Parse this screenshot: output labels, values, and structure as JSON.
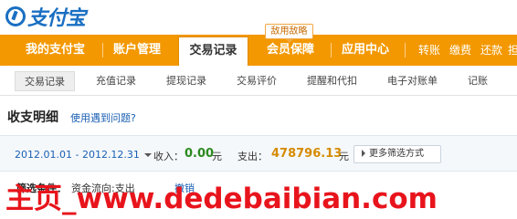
{
  "logo": {
    "text": "支付宝"
  },
  "badge_hint": "敌用敌略",
  "nav": {
    "items": [
      "我的支付宝",
      "账户管理",
      "交易记录",
      "会员保障",
      "应用中心"
    ],
    "active_index": 2,
    "quick_links": [
      "转账",
      "缴费",
      "还款",
      "担"
    ]
  },
  "subnav": {
    "items": [
      "交易记录",
      "充值记录",
      "提现记录",
      "交易评价",
      "提醒和代扣",
      "电子对账单",
      "记账"
    ],
    "active_index": 0
  },
  "page": {
    "title": "收支明细",
    "help_link": "使用遇到问题?"
  },
  "filter": {
    "date_range": "2012.01.01 - 2012.12.31",
    "income_label": "收入：",
    "income_value": "0.00",
    "income_unit": "元",
    "expense_label": "支出：",
    "expense_value": "478796.13",
    "expense_unit": "元",
    "more_button": "更多筛选方式"
  },
  "conditions": {
    "label": "筛选条件：",
    "item": "资金流向:支出",
    "clear": "撤销"
  },
  "watermark": "主页_www.dedebaibian.com",
  "colors": {
    "nav_orange": "#f39800",
    "link_blue": "#1a5fb4",
    "income_green": "#2b8a1e",
    "expense_orange": "#d58b00",
    "watermark_red": "#e8141c"
  }
}
